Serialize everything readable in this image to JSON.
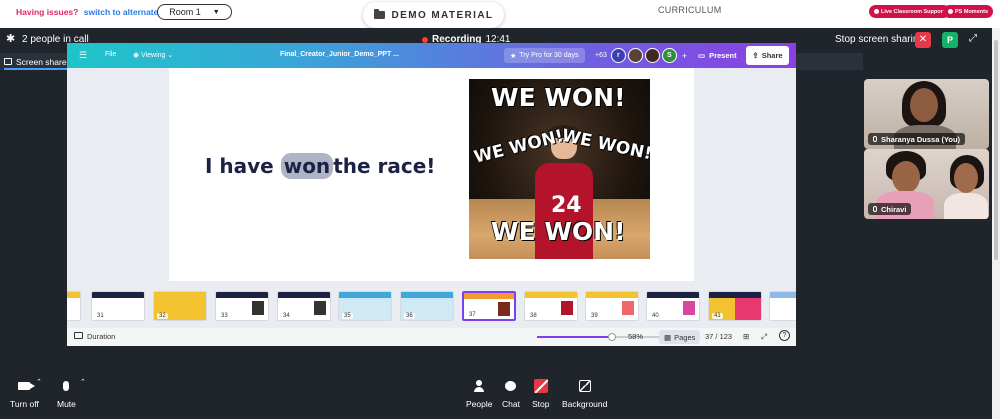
{
  "topbar": {
    "issues_text": "Having issues?",
    "alternate_room_link": "switch to alternate room",
    "room_select": "Room 1",
    "demo_material": "DEMO MATERIAL",
    "curriculum": "CURRICULUM",
    "live_support_label": "Live Classroom Support",
    "ps_moments_label": "PS Moments"
  },
  "callbar": {
    "people_count": "2 people in call",
    "recording_label": "Recording",
    "recording_time": "12:41",
    "stop_sharing": "Stop screen sharing",
    "participant_badge": "P"
  },
  "share_tab": {
    "label": "Screen share (You)",
    "menu": "•••"
  },
  "canva": {
    "file": "File",
    "viewing": "Viewing",
    "filename": "Final_Creator_Junior_Demo_PPT ...",
    "try_pro": "Try Pro for 30 days",
    "collaborator_count": "+63",
    "avatars": [
      {
        "letter": "r",
        "color": "#3b3fb0"
      },
      {
        "letter": "",
        "color": "#5a4035"
      },
      {
        "letter": "",
        "color": "#3e2a22"
      },
      {
        "letter": "S",
        "color": "#2f8f3c"
      }
    ],
    "add": "+",
    "present": "Present",
    "share": "Share"
  },
  "slide": {
    "text_before": "I have",
    "highlight": "won",
    "text_after": "the race!",
    "gif_lines": [
      "WE WON!",
      "WE WON!",
      "WE WON!",
      "WE WON!"
    ],
    "jersey_number": "24"
  },
  "thumbnails": [
    {
      "num": "31",
      "band": "#1c2244"
    },
    {
      "num": "32",
      "band": "#f2c230"
    },
    {
      "num": "33",
      "band": "#1c2244"
    },
    {
      "num": "34",
      "band": "#1c2244"
    },
    {
      "num": "35",
      "band": "#3fa8d8"
    },
    {
      "num": "36",
      "band": "#3fa8d8"
    },
    {
      "num": "37",
      "band": "#f29a30"
    },
    {
      "num": "38",
      "band": "#f2c230"
    },
    {
      "num": "39",
      "band": "#f2c230"
    },
    {
      "num": "40",
      "band": "#1c2244"
    },
    {
      "num": "41",
      "band": "#1c2244"
    }
  ],
  "status": {
    "duration": "Duration",
    "zoom": "58%",
    "zoom_fraction": 0.58,
    "pages_label": "Pages",
    "page_counter": "37 / 123",
    "help": "?"
  },
  "participants": [
    {
      "name": "Sharanya Dussa (You)"
    },
    {
      "name": "Chiravi"
    }
  ],
  "toolbar": {
    "turn_off": "Turn off",
    "mute": "Mute",
    "people": "People",
    "chat": "Chat",
    "stop": "Stop",
    "background": "Background"
  },
  "colors": {
    "call_bg": "#20242b",
    "recording_dot": "#ff3b3b",
    "stop_red": "#e53948",
    "badge_green": "#14b36b",
    "accent_purple": "#7d3ff0",
    "slide_text": "#1c2244"
  }
}
